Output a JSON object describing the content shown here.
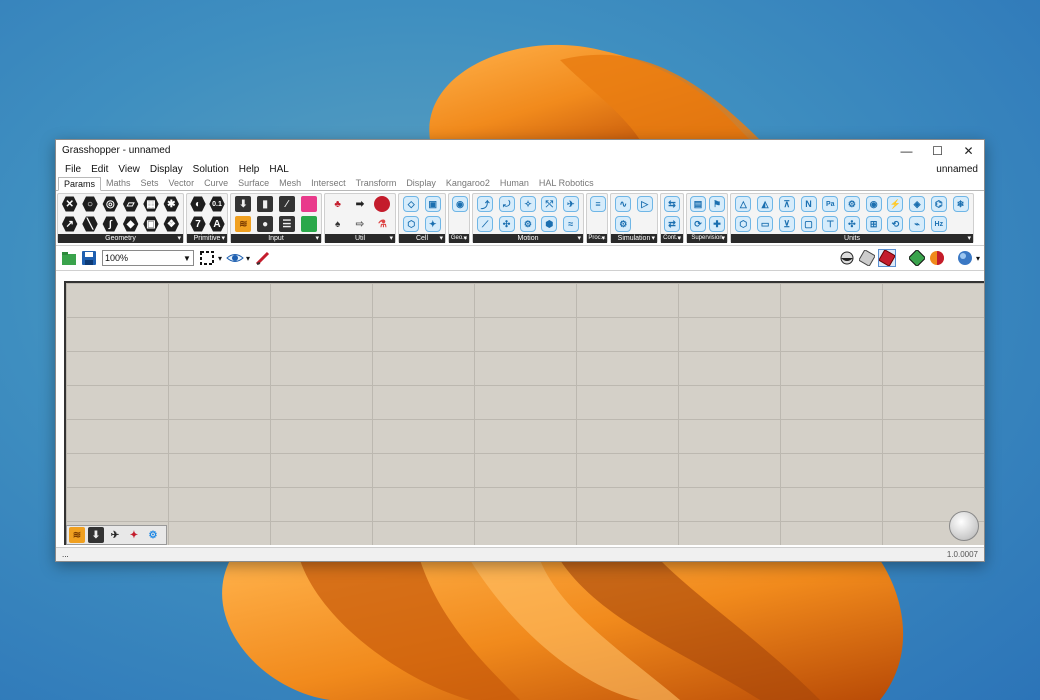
{
  "window": {
    "title": "Grasshopper - unnamed",
    "document_name": "unnamed"
  },
  "menu": [
    "File",
    "Edit",
    "View",
    "Display",
    "Solution",
    "Help",
    "HAL"
  ],
  "tabs": [
    "Params",
    "Maths",
    "Sets",
    "Vector",
    "Curve",
    "Surface",
    "Mesh",
    "Intersect",
    "Transform",
    "Display",
    "Kangaroo2",
    "Human",
    "HAL Robotics"
  ],
  "active_tab": "Params",
  "ribbon_groups": [
    {
      "label": "Geometry"
    },
    {
      "label": "Primitive"
    },
    {
      "label": "Input"
    },
    {
      "label": "Util"
    },
    {
      "label": "Cell"
    },
    {
      "label": "Geo..."
    },
    {
      "label": "Motion"
    },
    {
      "label": "Proc..."
    },
    {
      "label": "Simulation"
    },
    {
      "label": "Cont..."
    },
    {
      "label": "Supervision"
    },
    {
      "label": "Units"
    }
  ],
  "primitive_icons": {
    "a": "0.1",
    "b": "7",
    "c": "A"
  },
  "units_icons": {
    "n": "N",
    "pa": "Pa",
    "hz": "Hz"
  },
  "toolbar": {
    "zoom": "100%"
  },
  "status": {
    "left": "...",
    "version": "1.0.0007"
  }
}
